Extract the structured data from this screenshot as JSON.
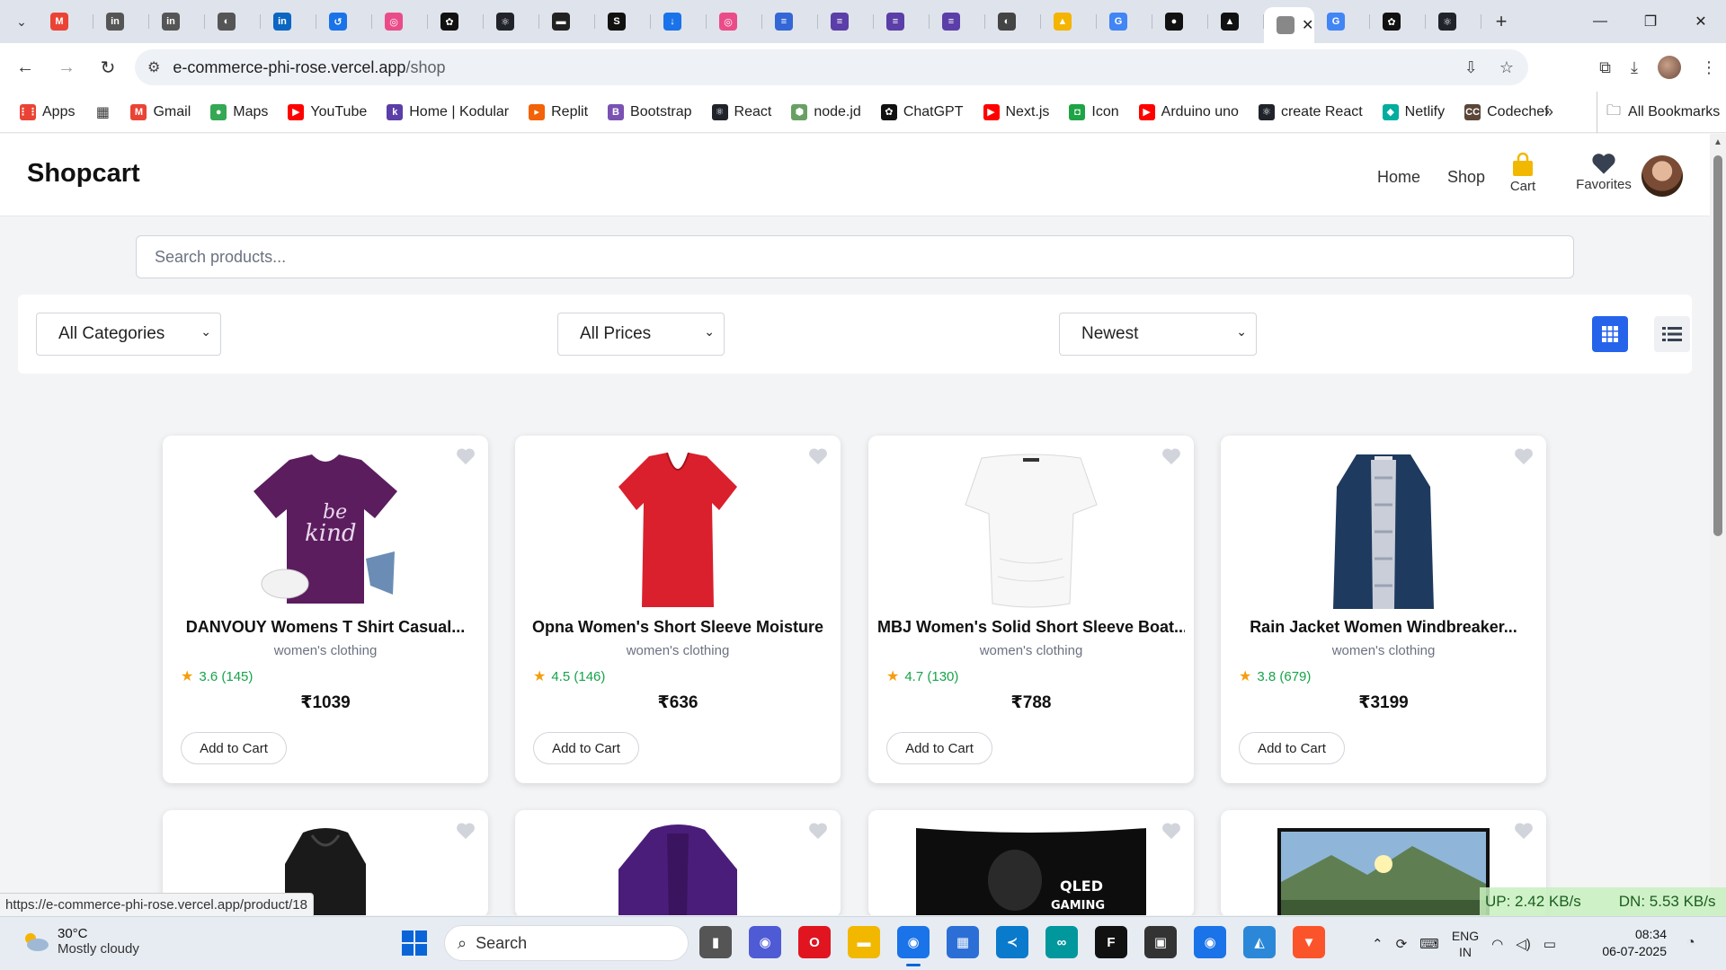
{
  "browser": {
    "tabs": [
      {
        "icon": "gmail-icon",
        "color": "#ea4335",
        "glyph": "M"
      },
      {
        "icon": "linkedin-learning-icon",
        "color": "#555555",
        "glyph": "in"
      },
      {
        "icon": "linkedin-learning-icon",
        "color": "#555555",
        "glyph": "in"
      },
      {
        "icon": "globe-icon",
        "color": "#555555",
        "glyph": "◐"
      },
      {
        "icon": "linkedin-icon",
        "color": "#0a66c2",
        "glyph": "in"
      },
      {
        "icon": "history-icon",
        "color": "#1a73e8",
        "glyph": "↺"
      },
      {
        "icon": "dribbble-icon",
        "color": "#ea4c89",
        "glyph": "◎"
      },
      {
        "icon": "openai-icon",
        "color": "#111111",
        "glyph": "✿"
      },
      {
        "icon": "react-icon",
        "color": "#20232a",
        "glyph": "⚛"
      },
      {
        "icon": "printer-icon",
        "color": "#222222",
        "glyph": "▬"
      },
      {
        "icon": "s-icon",
        "color": "#111111",
        "glyph": "S"
      },
      {
        "icon": "download-icon",
        "color": "#1a73e8",
        "glyph": "↓"
      },
      {
        "icon": "dribbble-icon",
        "color": "#ea4c89",
        "glyph": "◎"
      },
      {
        "icon": "forms-icon",
        "color": "#3367d6",
        "glyph": "≡"
      },
      {
        "icon": "docs-icon",
        "color": "#5b3ea8",
        "glyph": "≡"
      },
      {
        "icon": "docs-icon",
        "color": "#5b3ea8",
        "glyph": "≡"
      },
      {
        "icon": "docs-icon",
        "color": "#5b3ea8",
        "glyph": "≡"
      },
      {
        "icon": "globe-icon",
        "color": "#444444",
        "glyph": "◐"
      },
      {
        "icon": "hat-icon",
        "color": "#f4b400",
        "glyph": "▲"
      },
      {
        "icon": "google-icon",
        "color": "#4285f4",
        "glyph": "G"
      },
      {
        "icon": "github-icon",
        "color": "#111111",
        "glyph": "●"
      },
      {
        "icon": "vercel-icon",
        "color": "#111111",
        "glyph": "▲"
      }
    ],
    "active_tab_close": "✕",
    "tabs_after": [
      {
        "icon": "google-icon",
        "color": "#4285f4",
        "glyph": "G"
      },
      {
        "icon": "openai-icon",
        "color": "#111111",
        "glyph": "✿"
      },
      {
        "icon": "react-icon",
        "color": "#20232a",
        "glyph": "⚛"
      }
    ],
    "url_host": "e-commerce-phi-rose.vercel.app",
    "url_path": "/shop",
    "bookmarks": [
      {
        "label": "Apps",
        "color": "#ea4335",
        "glyph": "⋮⋮"
      },
      {
        "label": "",
        "color": "#ffffff",
        "glyph": "▦"
      },
      {
        "label": "Gmail",
        "color": "#ea4335",
        "glyph": "M"
      },
      {
        "label": "Maps",
        "color": "#34a853",
        "glyph": "●"
      },
      {
        "label": "YouTube",
        "color": "#ff0000",
        "glyph": "▶"
      },
      {
        "label": "Home | Kodular",
        "color": "#5b3ea8",
        "glyph": "k"
      },
      {
        "label": "Replit",
        "color": "#f26207",
        "glyph": "▸"
      },
      {
        "label": "Bootstrap",
        "color": "#7952b3",
        "glyph": "B"
      },
      {
        "label": "React",
        "color": "#20232a",
        "glyph": "⚛"
      },
      {
        "label": "node.jd",
        "color": "#68a063",
        "glyph": "⬢"
      },
      {
        "label": "ChatGPT",
        "color": "#111111",
        "glyph": "✿"
      },
      {
        "label": "Next.js",
        "color": "#ff0000",
        "glyph": "▶"
      },
      {
        "label": "Icon",
        "color": "#1ea446",
        "glyph": "◘"
      },
      {
        "label": "Arduino uno",
        "color": "#ff0000",
        "glyph": "▶"
      },
      {
        "label": "create React",
        "color": "#20232a",
        "glyph": "⚛"
      },
      {
        "label": "Netlify",
        "color": "#00ad9f",
        "glyph": "◆"
      },
      {
        "label": "Codechef",
        "color": "#5b4638",
        "glyph": "CC"
      }
    ],
    "bookmarks_more": "»",
    "all_bookmarks": "All Bookmarks"
  },
  "site": {
    "logo": "Shopcart",
    "nav_home": "Home",
    "nav_shop": "Shop",
    "nav_cart": "Cart",
    "nav_favorites": "Favorites",
    "search_placeholder": "Search products...",
    "filter_category": "All Categories",
    "filter_price": "All Prices",
    "sort": "Newest",
    "accent": "#2563eb"
  },
  "products": [
    {
      "title": "DANVOUY Womens T Shirt Casual...",
      "category": "women's clothing",
      "rating": "3.6 (145)",
      "price": "₹1039",
      "cta": "Add to Cart"
    },
    {
      "title": "Opna Women's Short Sleeve Moisture",
      "category": "women's clothing",
      "rating": "4.5 (146)",
      "price": "₹636",
      "cta": "Add to Cart"
    },
    {
      "title": "MBJ Women's Solid Short Sleeve Boat...",
      "category": "women's clothing",
      "rating": "4.7 (130)",
      "price": "₹788",
      "cta": "Add to Cart"
    },
    {
      "title": "Rain Jacket Women Windbreaker...",
      "category": "women's clothing",
      "rating": "3.8 (679)",
      "price": "₹3199",
      "cta": "Add to Cart"
    }
  ],
  "status": {
    "hover_url": "https://e-commerce-phi-rose.vercel.app/product/18",
    "net_up": "UP: 2.42 KB/s",
    "net_down": "DN: 5.53 KB/s"
  },
  "taskbar": {
    "temp": "30°C",
    "weather": "Mostly cloudy",
    "search_label": "Search",
    "lang_1": "ENG",
    "lang_2": "IN",
    "time": "08:34",
    "date": "06-07-2025",
    "apps": [
      {
        "icon": "file-explorer-icon",
        "color": "#555555",
        "glyph": "▮"
      },
      {
        "icon": "meet-icon",
        "color": "#4f5bd5",
        "glyph": "◉"
      },
      {
        "icon": "opera-icon",
        "color": "#e0151f",
        "glyph": "O"
      },
      {
        "icon": "folder-icon",
        "color": "#f2b800",
        "glyph": "▬"
      },
      {
        "icon": "chrome-icon",
        "color": "#1a73e8",
        "glyph": "◉",
        "active": true
      },
      {
        "icon": "store-icon",
        "color": "#2b6fd6",
        "glyph": "▦"
      },
      {
        "icon": "vscode-icon",
        "color": "#0a7acc",
        "glyph": "≺"
      },
      {
        "icon": "arduino-icon",
        "color": "#00979d",
        "glyph": "∞"
      },
      {
        "icon": "figma-icon",
        "color": "#111111",
        "glyph": "F"
      },
      {
        "icon": "app-icon",
        "color": "#333333",
        "glyph": "▣"
      },
      {
        "icon": "chrome-icon",
        "color": "#1a73e8",
        "glyph": "◉"
      },
      {
        "icon": "photos-icon",
        "color": "#2b88d8",
        "glyph": "◭"
      },
      {
        "icon": "brave-icon",
        "color": "#fb542b",
        "glyph": "▼"
      }
    ]
  }
}
